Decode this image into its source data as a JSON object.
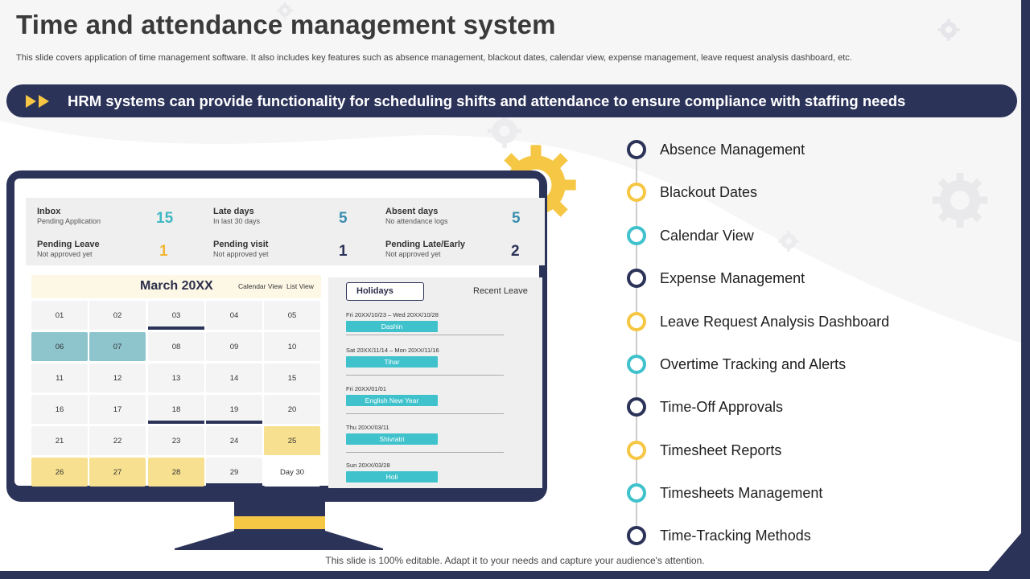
{
  "title": "Time and attendance management system",
  "subtitle": "This slide covers application of time management software. It also includes key features such as absence management, blackout dates, calendar view, expense management, leave request analysis dashboard, etc.",
  "banner": "HRM systems can provide functionality for scheduling shifts and attendance to ensure compliance with staffing needs",
  "colors": {
    "navy": "#2c3359",
    "yellow": "#f6c744",
    "teal": "#40c2cc"
  },
  "dashboard": {
    "stats": [
      {
        "title": "Inbox",
        "sub": "Pending Application",
        "value": "15",
        "color": "#40b8c4"
      },
      {
        "title": "Late days",
        "sub": "In last 30 days",
        "value": "5",
        "color": "#3a8fb0"
      },
      {
        "title": "Absent days",
        "sub": "No attendance logs",
        "value": "5",
        "color": "#3a8fb0"
      },
      {
        "title": "Pending Leave",
        "sub": "Not approved yet",
        "value": "1",
        "color": "#f2b632"
      },
      {
        "title": "Pending visit",
        "sub": "Not approved yet",
        "value": "1",
        "color": "#2c3359"
      },
      {
        "title": "Pending Late/Early",
        "sub": "Not approved yet",
        "value": "2",
        "color": "#2c3359"
      }
    ],
    "calendar": {
      "month": "March 20XX",
      "calendar_view": "Calendar View",
      "list_view": "List View",
      "days": [
        "01",
        "02",
        "03",
        "04",
        "05",
        "06",
        "07",
        "08",
        "09",
        "10",
        "11",
        "12",
        "13",
        "14",
        "15",
        "16",
        "17",
        "18",
        "19",
        "20",
        "21",
        "22",
        "23",
        "24",
        "25",
        "26",
        "27",
        "28",
        "29",
        "Day 30"
      ]
    },
    "holidays": {
      "tab": "Holidays",
      "recent": "Recent Leave",
      "items": [
        {
          "date": "Fri 20XX/10/23   – Wed 20XX/10/28",
          "name": "Dashin"
        },
        {
          "date": "Sat 20XX/11/14   – Mon 20XX/11/16",
          "name": "Tihar"
        },
        {
          "date": "Fri 20XX/01/01",
          "name": "English New Year"
        },
        {
          "date": "Thu 20XX/03/11",
          "name": "Shivratri"
        },
        {
          "date": "Sun 20XX/03/28",
          "name": "Holi"
        }
      ]
    }
  },
  "features": [
    {
      "label": "Absence Management",
      "color": "#2c3359"
    },
    {
      "label": "Blackout Dates",
      "color": "#f6c744"
    },
    {
      "label": "Calendar View",
      "color": "#40c2cc"
    },
    {
      "label": "Expense Management",
      "color": "#2c3359"
    },
    {
      "label": "Leave Request Analysis Dashboard",
      "color": "#f6c744"
    },
    {
      "label": "Overtime Tracking and Alerts",
      "color": "#40c2cc"
    },
    {
      "label": "Time-Off Approvals",
      "color": "#2c3359"
    },
    {
      "label": "Timesheet Reports",
      "color": "#f6c744"
    },
    {
      "label": "Timesheets Management",
      "color": "#40c2cc"
    },
    {
      "label": "Time-Tracking Methods",
      "color": "#2c3359"
    }
  ],
  "footer": "This slide is 100% editable. Adapt it to your needs and capture your audience's attention."
}
